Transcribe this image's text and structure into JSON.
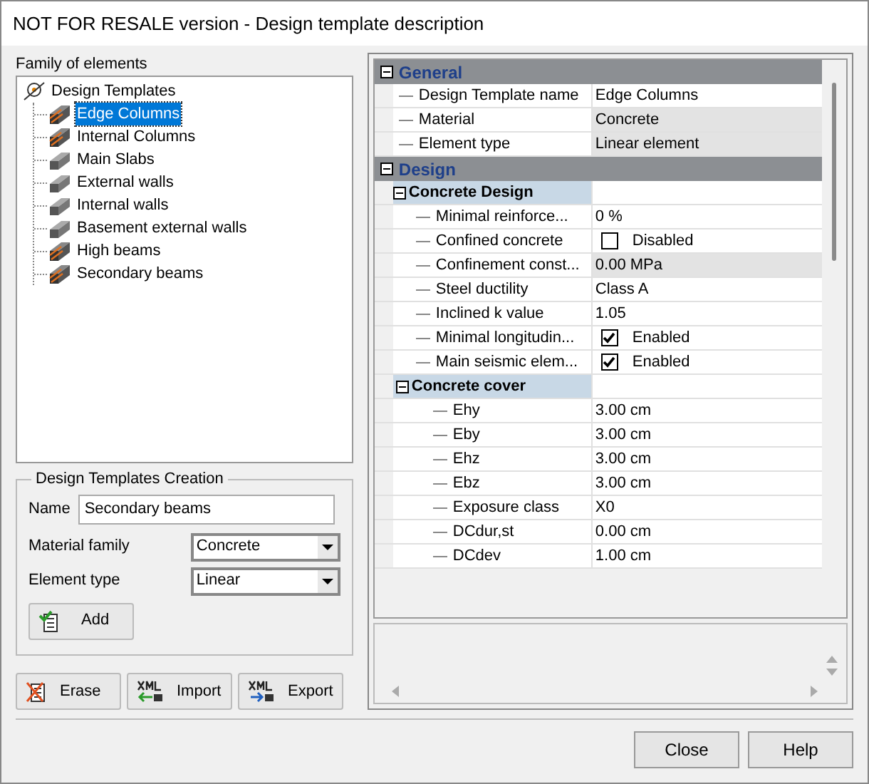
{
  "window": {
    "title": "NOT FOR RESALE version - Design template description"
  },
  "family": {
    "label": "Family of elements",
    "root": "Design Templates",
    "items": [
      {
        "label": "Edge Columns",
        "kind": "linear",
        "selected": true
      },
      {
        "label": "Internal Columns",
        "kind": "linear",
        "selected": false
      },
      {
        "label": "Main Slabs",
        "kind": "surface",
        "selected": false
      },
      {
        "label": "External walls",
        "kind": "surface",
        "selected": false
      },
      {
        "label": "Internal walls",
        "kind": "surface",
        "selected": false
      },
      {
        "label": "Basement external walls",
        "kind": "surface",
        "selected": false
      },
      {
        "label": "High beams",
        "kind": "linear",
        "selected": false
      },
      {
        "label": "Secondary beams",
        "kind": "linear",
        "selected": false
      }
    ]
  },
  "creation": {
    "title": "Design Templates Creation",
    "name_label": "Name",
    "name_value": "Secondary beams",
    "material_label": "Material family",
    "material_value": "Concrete",
    "type_label": "Element type",
    "type_value": "Linear",
    "add": "Add"
  },
  "actions": [
    {
      "label": "Erase",
      "kind": "erase"
    },
    {
      "label": "Import",
      "kind": "import"
    },
    {
      "label": "Export",
      "kind": "export"
    }
  ],
  "properties": [
    {
      "kind": "section",
      "label": "General",
      "expanded": true,
      "children": [
        {
          "kind": "text",
          "label": "Design Template name",
          "value": "Edge Columns",
          "readonly": false
        },
        {
          "kind": "text",
          "label": "Material",
          "value": "Concrete",
          "readonly": true
        },
        {
          "kind": "text",
          "label": "Element type",
          "value": "Linear element",
          "readonly": true
        }
      ]
    },
    {
      "kind": "section",
      "label": "Design",
      "expanded": true,
      "children": [
        {
          "kind": "category",
          "label": "Concrete Design",
          "expanded": true,
          "children": [
            {
              "kind": "text",
              "label": "Minimal reinforce...",
              "value": "0 %",
              "readonly": false
            },
            {
              "kind": "check",
              "label": "Confined concrete",
              "value": "Disabled",
              "checked": false
            },
            {
              "kind": "text",
              "label": "Confinement const...",
              "value": "0.00 MPa",
              "readonly": true
            },
            {
              "kind": "text",
              "label": "Steel ductility",
              "value": "Class A",
              "readonly": false
            },
            {
              "kind": "text",
              "label": "Inclined k value",
              "value": "1.05",
              "readonly": false
            },
            {
              "kind": "check",
              "label": "Minimal longitudin...",
              "value": "Enabled",
              "checked": true
            },
            {
              "kind": "check",
              "label": "Main seismic elem...",
              "value": "Enabled",
              "checked": true
            },
            {
              "kind": "category",
              "label": "Concrete cover",
              "expanded": true,
              "children": [
                {
                  "kind": "text",
                  "label": "Ehy",
                  "value": "3.00 cm",
                  "readonly": false
                },
                {
                  "kind": "text",
                  "label": "Eby",
                  "value": "3.00 cm",
                  "readonly": false
                },
                {
                  "kind": "text",
                  "label": "Ehz",
                  "value": "3.00 cm",
                  "readonly": false
                },
                {
                  "kind": "text",
                  "label": "Ebz",
                  "value": "3.00 cm",
                  "readonly": false
                },
                {
                  "kind": "text",
                  "label": "Exposure class",
                  "value": "X0",
                  "readonly": false
                },
                {
                  "kind": "text",
                  "label": "DCdur,st",
                  "value": "0.00 cm",
                  "readonly": false
                },
                {
                  "kind": "text",
                  "label": "DCdev",
                  "value": "1.00 cm",
                  "readonly": false
                }
              ]
            }
          ]
        }
      ]
    }
  ],
  "buttons": [
    {
      "label": "Close"
    },
    {
      "label": "Help"
    }
  ]
}
